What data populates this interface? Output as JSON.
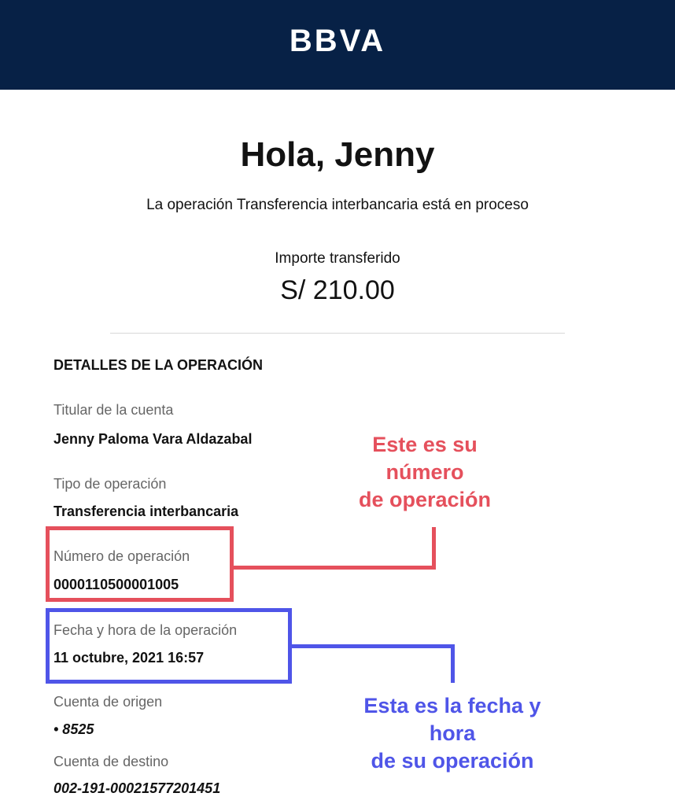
{
  "header": {
    "brand": "BBVA",
    "background": "#072146"
  },
  "greeting": "Hola, Jenny",
  "status_message": "La operación Transferencia interbancaria está en proceso",
  "amount": {
    "label": "Importe transferido",
    "value": "S/ 210.00"
  },
  "details": {
    "title": "DETALLES DE LA OPERACIÓN",
    "fields": [
      {
        "label": "Titular de la cuenta",
        "value": "Jenny Paloma Vara Aldazabal"
      },
      {
        "label": "Tipo de operación",
        "value": "Transferencia interbancaria"
      },
      {
        "label": "Número de operación",
        "value": "0000110500001005"
      },
      {
        "label": "Fecha y hora de la operación",
        "value": "11 octubre, 2021 16:57"
      },
      {
        "label": "Cuenta de origen",
        "value": "• 8525"
      },
      {
        "label": "Cuenta de destino",
        "value": "002-191-00021577201451"
      }
    ]
  },
  "annotations": {
    "operation_number_note": [
      "Este es su",
      "número",
      "de operación"
    ],
    "datetime_note": [
      "Esta es la fecha y",
      "hora",
      "de su operación"
    ],
    "colors": {
      "red": "#e5505c",
      "blue": "#4f55e8"
    }
  }
}
